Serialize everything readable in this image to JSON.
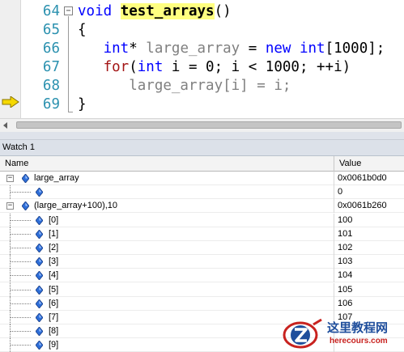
{
  "editor": {
    "lines": [
      {
        "num": "64",
        "fold": "−",
        "parts": [
          {
            "t": "void",
            "c": "kw"
          },
          {
            "t": " ",
            "c": ""
          },
          {
            "t": "test_arrays",
            "c": "fn"
          },
          {
            "t": "()",
            "c": ""
          }
        ]
      },
      {
        "num": "65",
        "fold": "",
        "parts": [
          {
            "t": "{",
            "c": ""
          }
        ]
      },
      {
        "num": "66",
        "fold": "",
        "parts": [
          {
            "t": "   ",
            "c": ""
          },
          {
            "t": "int",
            "c": "kw"
          },
          {
            "t": "* ",
            "c": ""
          },
          {
            "t": "large_array",
            "c": "grey"
          },
          {
            "t": " = ",
            "c": ""
          },
          {
            "t": "new",
            "c": "kw"
          },
          {
            "t": " ",
            "c": ""
          },
          {
            "t": "int",
            "c": "kw"
          },
          {
            "t": "[1000];",
            "c": ""
          }
        ]
      },
      {
        "num": "67",
        "fold": "",
        "parts": [
          {
            "t": "   ",
            "c": ""
          },
          {
            "t": "for",
            "c": "kw2"
          },
          {
            "t": "(",
            "c": ""
          },
          {
            "t": "int",
            "c": "kw"
          },
          {
            "t": " i = 0; i < 1000; ++i)",
            "c": ""
          }
        ]
      },
      {
        "num": "68",
        "fold": "",
        "parts": [
          {
            "t": "      ",
            "c": ""
          },
          {
            "t": "large_array[i] = i;",
            "c": "grey"
          }
        ]
      },
      {
        "num": "69",
        "fold": "",
        "parts": [
          {
            "t": "}",
            "c": ""
          }
        ]
      }
    ],
    "current_line": "69"
  },
  "watch": {
    "title": "Watch 1",
    "col_name": "Name",
    "col_value": "Value",
    "rows": [
      {
        "name": "large_array",
        "value": "0x0061b0d0",
        "expander": "−",
        "level": 0
      },
      {
        "name": "",
        "value": "0",
        "expander": "",
        "level": 1
      },
      {
        "name": "(large_array+100),10",
        "value": "0x0061b260",
        "expander": "−",
        "level": 0
      },
      {
        "name": "[0]",
        "value": "100",
        "expander": "",
        "level": 1
      },
      {
        "name": "[1]",
        "value": "101",
        "expander": "",
        "level": 1
      },
      {
        "name": "[2]",
        "value": "102",
        "expander": "",
        "level": 1
      },
      {
        "name": "[3]",
        "value": "103",
        "expander": "",
        "level": 1
      },
      {
        "name": "[4]",
        "value": "104",
        "expander": "",
        "level": 1
      },
      {
        "name": "[5]",
        "value": "105",
        "expander": "",
        "level": 1
      },
      {
        "name": "[6]",
        "value": "106",
        "expander": "",
        "level": 1
      },
      {
        "name": "[7]",
        "value": "107",
        "expander": "",
        "level": 1
      },
      {
        "name": "[8]",
        "value": "",
        "expander": "",
        "level": 1
      },
      {
        "name": "[9]",
        "value": "",
        "expander": "",
        "level": 1
      }
    ]
  },
  "watermark": {
    "cn": "这里教程网",
    "url": "herecours.com"
  },
  "colors": {
    "keyword": "#0000ff",
    "control_keyword": "#a31515",
    "line_number": "#2b91af",
    "highlight": "#ffff80",
    "arrow": "#f5d800"
  },
  "icons": [
    "current-statement-arrow-icon",
    "collapse-icon",
    "left-arrow-icon",
    "variable-gem-icon",
    "expand-collapse-icon",
    "watermark-logo-icon"
  ]
}
